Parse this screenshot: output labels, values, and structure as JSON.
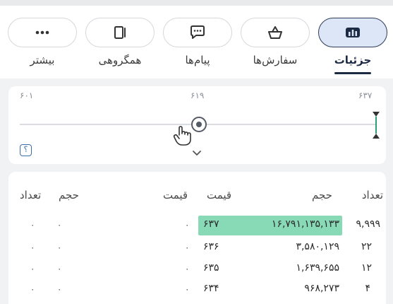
{
  "tabs": [
    {
      "label": "جزئیات",
      "icon": "chart-icon",
      "active": true
    },
    {
      "label": "سفارش‌ها",
      "icon": "basket-icon",
      "active": false
    },
    {
      "label": "پیام‌ها",
      "icon": "chat-icon",
      "active": false
    },
    {
      "label": "همگروهی",
      "icon": "copy-icon",
      "active": false
    },
    {
      "label": "بیشتر",
      "icon": "more-icon",
      "active": false
    }
  ],
  "price_range": {
    "low": "۶۰۱",
    "mid": "۶۱۹",
    "high": "۶۳۷",
    "help_label": "؟"
  },
  "order_book": {
    "headers": {
      "count": "تعداد",
      "volume": "حجم",
      "price": "قیمت",
      "sell_price": "قیمت",
      "sell_volume": "حجم",
      "sell_count": "تعداد"
    },
    "rows": [
      {
        "count": "۹,۹۹۹",
        "volume": "۱۶,۷۹۱,۱۳۵,۱۳۳",
        "price": "۶۳۷",
        "sell_price": "۰",
        "sell_volume": "۰",
        "sell_count": "۰"
      },
      {
        "count": "۲۲",
        "volume": "۳,۵۸۰,۱۲۹",
        "price": "۶۳۶",
        "sell_price": "۰",
        "sell_volume": "۰",
        "sell_count": "۰"
      },
      {
        "count": "۱۲",
        "volume": "۱,۶۳۹,۶۵۵",
        "price": "۶۳۵",
        "sell_price": "۰",
        "sell_volume": "۰",
        "sell_count": "۰"
      },
      {
        "count": "۴",
        "volume": "۹۶۸,۲۷۳",
        "price": "۶۳۴",
        "sell_price": "۰",
        "sell_volume": "۰",
        "sell_count": "۰"
      }
    ]
  },
  "colors": {
    "accent": "#1d2a44",
    "active_tab_bg": "#dde6f7",
    "highlight": "#88d9b6"
  }
}
